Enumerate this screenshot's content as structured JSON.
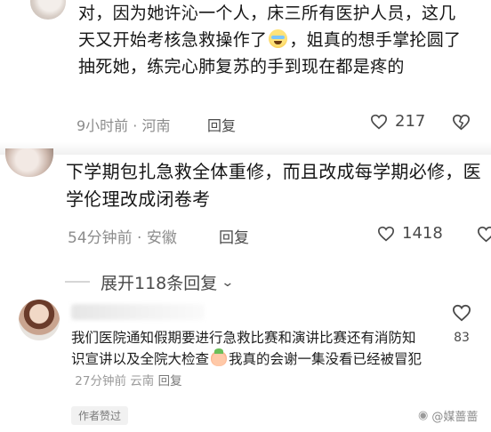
{
  "comment1": {
    "text_before_emoji": "对，因为她许沁一个人，床三所有医护人员，这几天又开始考核急救操作了",
    "emoji": "grinning-sweat-emoji",
    "text_after_emoji": "，姐真的想手掌抡圆了抽死她，练完心肺复苏的手到现在都是疼的",
    "time": "9小时前",
    "location": "河南",
    "reply_label": "回复",
    "like_count": "217"
  },
  "comment2": {
    "text": "下学期包扎急救全体重修，而且改成每学期必修，医学伦理改成闭卷考",
    "time": "54分钟前",
    "location": "安徽",
    "reply_label": "回复",
    "like_count": "1418"
  },
  "expand": {
    "label": "展开118条回复"
  },
  "comment3": {
    "text_before_emoji": "我们医院通知假期要进行急救比赛和演讲比赛还有消防知识宣讲以及全院大检查",
    "emoji": "peach-face-emoji",
    "text_after_emoji": "我真的会谢一集没看已经被冒犯",
    "time": "27分钟前",
    "location": "云南",
    "reply_label": "回复",
    "like_count": "83",
    "badge": "作者赞过"
  },
  "watermark": {
    "text": "@媒蔷蔷"
  },
  "colors": {
    "text": "#161616",
    "meta": "#8c8c8c",
    "icon": "#4a4a4a"
  }
}
